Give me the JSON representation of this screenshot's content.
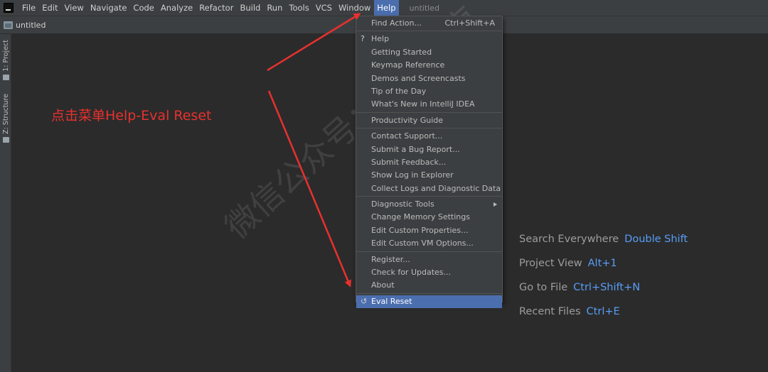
{
  "menubar": {
    "items": [
      "File",
      "Edit",
      "View",
      "Navigate",
      "Code",
      "Analyze",
      "Refactor",
      "Build",
      "Run",
      "Tools",
      "VCS",
      "Window",
      "Help"
    ],
    "active_item": "Help",
    "title": "untitled"
  },
  "navbar": {
    "project_label": "untitled",
    "icon": "folder-icon"
  },
  "toolstrip": {
    "project_tab": "1: Project",
    "structure_tab": "Z: Structure"
  },
  "annotation": "点击菜单Help-Eval Reset",
  "help_menu": {
    "items": [
      {
        "label": "Find Action...",
        "shortcut": "Ctrl+Shift+A"
      },
      {
        "label": "Help",
        "icon": "question-icon"
      },
      {
        "label": "Getting Started"
      },
      {
        "label": "Keymap Reference"
      },
      {
        "label": "Demos and Screencasts"
      },
      {
        "label": "Tip of the Day"
      },
      {
        "label": "What's New in IntelliJ IDEA"
      },
      {
        "label": "Productivity Guide"
      },
      {
        "label": "Contact Support..."
      },
      {
        "label": "Submit a Bug Report..."
      },
      {
        "label": "Submit Feedback..."
      },
      {
        "label": "Show Log in Explorer"
      },
      {
        "label": "Collect Logs and Diagnostic Data"
      },
      {
        "label": "Diagnostic Tools"
      },
      {
        "label": "Change Memory Settings"
      },
      {
        "label": "Edit Custom Properties..."
      },
      {
        "label": "Edit Custom VM Options..."
      },
      {
        "label": "Register..."
      },
      {
        "label": "Check for Updates..."
      },
      {
        "label": "About"
      },
      {
        "label": "Eval Reset",
        "icon": "reset-icon",
        "selected": true
      }
    ]
  },
  "welcome_hints": [
    {
      "label": "Search Everywhere",
      "shortcut": "Double Shift"
    },
    {
      "label": "Project View",
      "shortcut": "Alt+1"
    },
    {
      "label": "Go to File",
      "shortcut": "Ctrl+Shift+N"
    },
    {
      "label": "Recent Files",
      "shortcut": "Ctrl+E"
    }
  ],
  "watermark": "微信公众号：软件指南",
  "colors": {
    "accent": "#4b6eaf",
    "annotation_red": "#e8312e",
    "shortcut_blue": "#589df6"
  }
}
